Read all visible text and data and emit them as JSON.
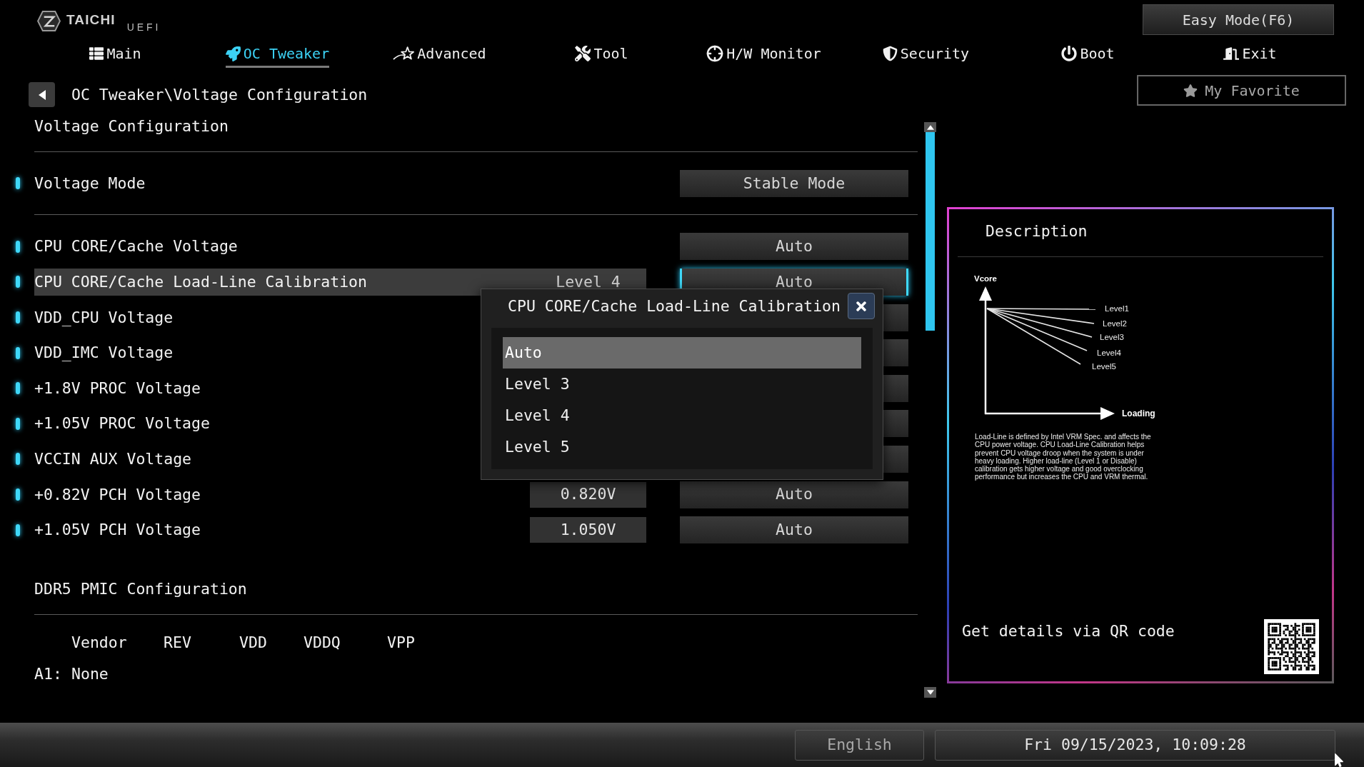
{
  "header": {
    "logo": {
      "brand": "TAICHI",
      "product": "UEFI"
    },
    "easy_mode_button": "Easy Mode(F6)",
    "favorite_button": "My Favorite"
  },
  "tabs": [
    {
      "label": "Main",
      "selected": false
    },
    {
      "label": "OC Tweaker",
      "selected": true
    },
    {
      "label": "Advanced",
      "selected": false
    },
    {
      "label": "Tool",
      "selected": false
    },
    {
      "label": "H/W Monitor",
      "selected": false
    },
    {
      "label": "Security",
      "selected": false
    },
    {
      "label": "Boot",
      "selected": false
    },
    {
      "label": "Exit",
      "selected": false
    }
  ],
  "breadcrumb": "OC Tweaker\\Voltage Configuration",
  "section_title": "Voltage Configuration",
  "mode_setting": {
    "label": "Voltage Mode",
    "option": "Stable Mode"
  },
  "settings": [
    {
      "label": "CPU CORE/Cache Voltage",
      "option": "Auto",
      "selected": false
    },
    {
      "label": "CPU CORE/Cache Load-Line Calibration",
      "value": "Level 4",
      "option": "Auto",
      "selected": true
    },
    {
      "label": "VDD_CPU Voltage",
      "selected": false
    },
    {
      "label": "VDD_IMC Voltage",
      "selected": false
    },
    {
      "label": "+1.8V PROC Voltage",
      "selected": false
    },
    {
      "label": "+1.05V PROC Voltage",
      "selected": false
    },
    {
      "label": "VCCIN AUX Voltage",
      "selected": false
    },
    {
      "label": "+0.82V PCH Voltage",
      "value": "0.820V",
      "option": "Auto",
      "selected": false
    },
    {
      "label": "+1.05V PCH Voltage",
      "value": "1.050V",
      "option": "Auto",
      "selected": false
    }
  ],
  "pmic": {
    "title": "DDR5 PMIC Configuration",
    "columns": [
      "Vendor",
      "REV",
      "VDD",
      "VDDQ",
      "VPP"
    ],
    "rows": [
      {
        "slot": "A1:",
        "cells": [
          "None"
        ]
      }
    ]
  },
  "popup": {
    "title": "CPU CORE/Cache Load-Line Calibration",
    "options": [
      {
        "label": "Auto",
        "selected": true
      },
      {
        "label": "Level 3",
        "selected": false
      },
      {
        "label": "Level 4",
        "selected": false
      },
      {
        "label": "Level 5",
        "selected": false
      }
    ]
  },
  "description": {
    "title": "Description",
    "diagram": {
      "y_axis_label": "Vcore",
      "x_axis_label": "Loading",
      "lines": [
        "Level1",
        "Level2",
        "Level3",
        "Level4",
        "Level5"
      ]
    },
    "text": "Load-Line is defined by Intel VRM Spec. and affects the CPU power voltage. CPU Load-Line Calibration helps prevent CPU voltage droop when the system is under heavy loading. Higher load-line (Level 1 or Disable) calibration gets higher voltage and good overclocking performance but increases the CPU and VRM thermal.",
    "qr_caption": "Get details via QR code"
  },
  "status_bar": {
    "language": "English",
    "datetime": "Fri 09/15/2023, 10:09:28"
  }
}
